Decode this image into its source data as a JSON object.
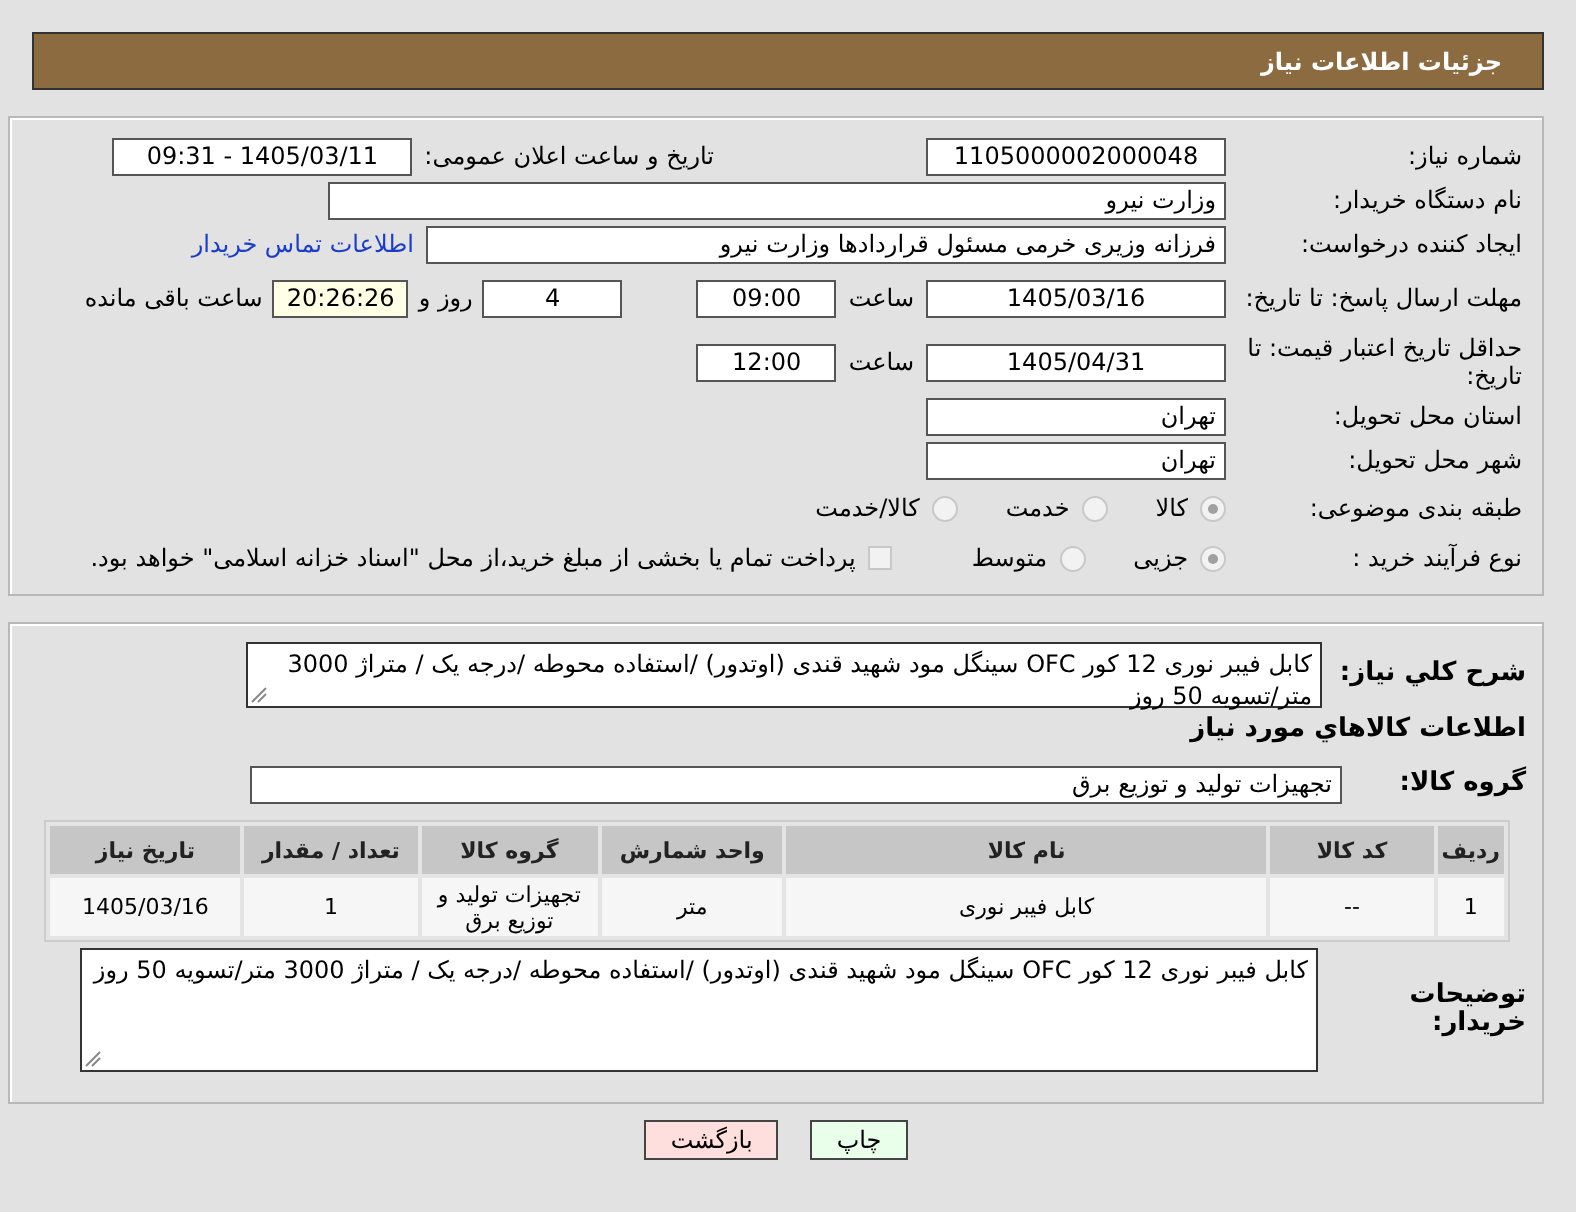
{
  "header": {
    "title": "جزئیات اطلاعات نیاز"
  },
  "need_number": {
    "label": "شماره نیاز:",
    "value": "1105000002000048"
  },
  "announce": {
    "label": "تاریخ و ساعت اعلان عمومی:",
    "value": "1405/03/11 - 09:31"
  },
  "buyer_org": {
    "label": "نام دستگاه خریدار:",
    "value": "وزارت نیرو"
  },
  "creator": {
    "label": "ایجاد کننده درخواست:",
    "value": "فرزانه وزیری خرمی مسئول قراردادها وزارت نیرو",
    "link": "اطلاعات تماس خریدار"
  },
  "deadline": {
    "label": "مهلت ارسال پاسخ: تا تاریخ:",
    "date": "1405/03/16",
    "time_label": "ساعت",
    "time": "09:00",
    "days": "4",
    "days_label": "روز و",
    "remaining": "20:26:26",
    "remaining_label": "ساعت باقی مانده"
  },
  "validity": {
    "label": "حداقل تاریخ اعتبار قیمت: تا تاریخ:",
    "date": "1405/04/31",
    "time_label": "ساعت",
    "time": "12:00"
  },
  "province": {
    "label": "استان محل تحویل:",
    "value": "تهران"
  },
  "city": {
    "label": "شهر محل تحویل:",
    "value": "تهران"
  },
  "category": {
    "label": "طبقه بندی موضوعی:",
    "options": [
      {
        "label": "کالا",
        "selected": true
      },
      {
        "label": "خدمت",
        "selected": false
      },
      {
        "label": "کالا/خدمت",
        "selected": false
      }
    ]
  },
  "process": {
    "label": "نوع فرآیند خرید :",
    "options": [
      {
        "label": "جزیی",
        "selected": true
      },
      {
        "label": "متوسط",
        "selected": false
      }
    ],
    "treasury": {
      "label": "پرداخت تمام یا بخشی از مبلغ خرید،از محل \"اسناد خزانه اسلامی\" خواهد بود.",
      "checked": false
    }
  },
  "summary": {
    "label": "شرح كلي نياز:",
    "value": "کابل فیبر نوری 12 کور OFC سینگل مود شهید قندی (اوتدور) /استفاده محوطه /درجه یک / متراژ 3000 متر/تسویه 50 روز"
  },
  "goods_heading": "اطلاعات كالاهاي مورد نياز",
  "goods_group": {
    "label": "گروه كالا:",
    "value": "تجهیزات تولید و توزیع برق"
  },
  "table": {
    "columns": [
      "ردیف",
      "کد کالا",
      "نام کالا",
      "واحد شمارش",
      "گروه کالا",
      "تعداد / مقدار",
      "تاریخ نیاز"
    ],
    "rows": [
      [
        "1",
        "--",
        "کابل فیبر نوری",
        "متر",
        "تجهیزات تولید و توزیع برق",
        "1",
        "1405/03/16"
      ]
    ]
  },
  "buyer_notes": {
    "label": "توضیحات خریدار:",
    "value": "کابل فیبر نوری 12 کور OFC سینگل مود شهید قندی (اوتدور) /استفاده محوطه /درجه یک / متراژ 3000 متر/تسویه 50 روز"
  },
  "buttons": [
    {
      "label": "چاپ",
      "kind": "print"
    },
    {
      "label": "بازگشت",
      "kind": "back"
    }
  ]
}
